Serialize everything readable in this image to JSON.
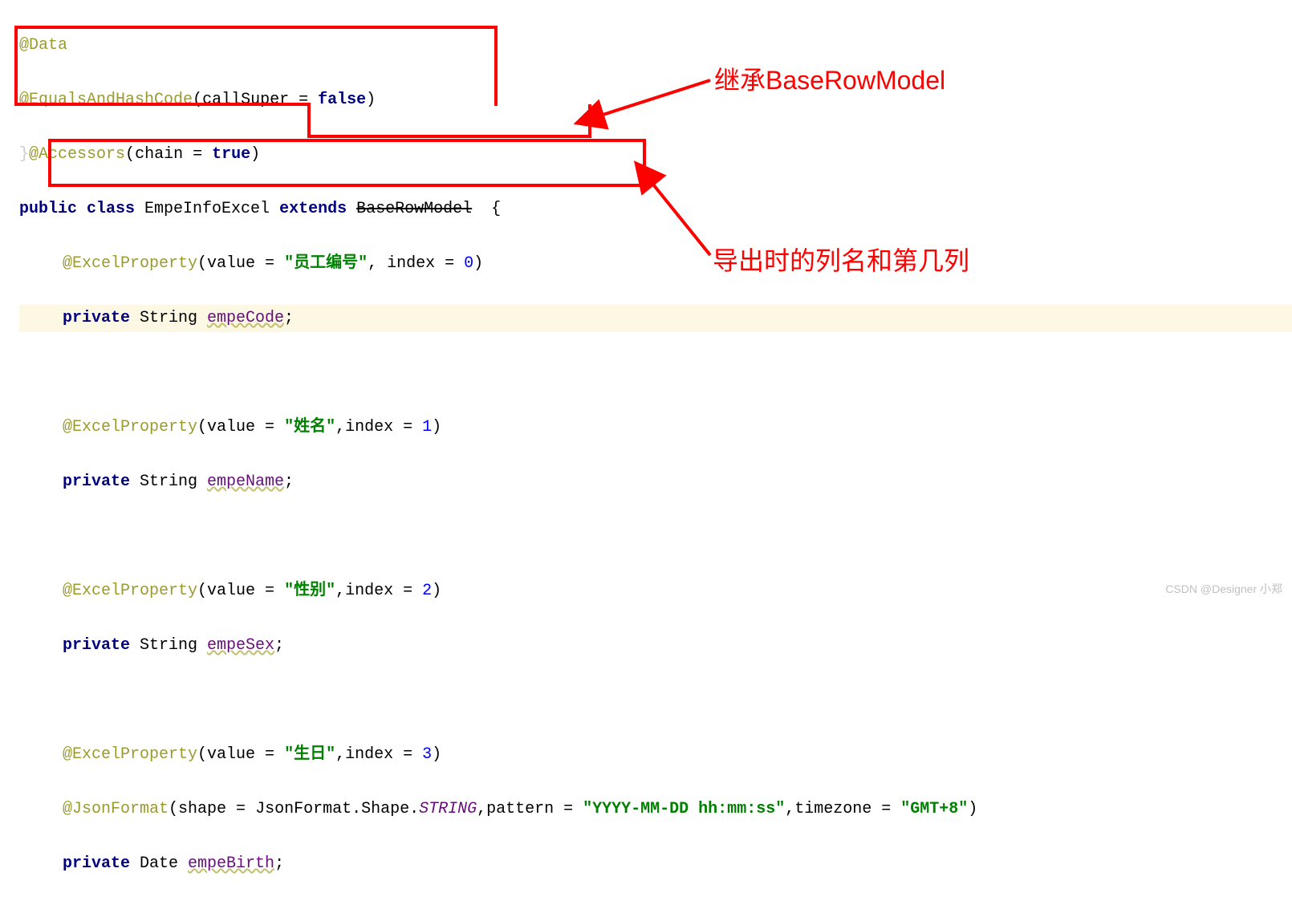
{
  "code": {
    "l1_anno": "@Data",
    "l2_anno": "@EqualsAndHashCode",
    "l2_paren_open": "(",
    "l2_param": "callSuper = ",
    "l2_val": "false",
    "l2_paren_close": ")",
    "l3_extra": "}",
    "l3_anno": "@Accessors",
    "l3_paren_open": "(",
    "l3_param": "chain = ",
    "l3_val": "true",
    "l3_paren_close": ")",
    "l4_public": "public",
    "l4_class": " class ",
    "l4_name": "EmpeInfoExcel",
    "l4_extends": " extends ",
    "l4_base": "BaseRowModel",
    "l4_brace": "  {",
    "l5_anno": "@ExcelProperty",
    "l5_paren_open": "(",
    "l5_value_kw": "value = ",
    "l5_value_str": "\"员工编号\"",
    "l5_comma": ", index = ",
    "l5_index": "0",
    "l5_paren_close": ")",
    "l6_private": "private",
    "l6_type": " String ",
    "l6_field": "empeCode",
    "l6_semi": ";",
    "l8_anno": "@ExcelProperty",
    "l8_paren_open": "(",
    "l8_value_kw": "value = ",
    "l8_value_str": "\"姓名\"",
    "l8_index_kw": ",index = ",
    "l8_index": "1",
    "l8_paren_close": ")",
    "l9_private": "private",
    "l9_type": " String ",
    "l9_field": "empeName",
    "l9_semi": ";",
    "l11_anno": "@ExcelProperty",
    "l11_paren_open": "(",
    "l11_value_kw": "value = ",
    "l11_value_str": "\"性别\"",
    "l11_index_kw": ",index = ",
    "l11_index": "2",
    "l11_paren_close": ")",
    "l12_private": "private",
    "l12_type": " String ",
    "l12_field": "empeSex",
    "l12_semi": ";",
    "l14_anno": "@ExcelProperty",
    "l14_paren_open": "(",
    "l14_value_kw": "value = ",
    "l14_value_str": "\"生日\"",
    "l14_index_kw": ",index = ",
    "l14_index": "3",
    "l14_paren_close": ")",
    "l15_anno": "@JsonFormat",
    "l15_paren_open": "(",
    "l15_shape_kw": "shape = ",
    "l15_shape_class": "JsonFormat.Shape.",
    "l15_shape_val": "STRING",
    "l15_pattern_kw": ",pattern = ",
    "l15_pattern_str": "\"YYYY-MM-DD hh:mm:ss\"",
    "l15_tz_kw": ",timezone = ",
    "l15_tz_str": "\"GMT+8\"",
    "l15_paren_close": ")",
    "l16_private": "private",
    "l16_type": " Date ",
    "l16_field": "empeBirth",
    "l16_semi": ";"
  },
  "labels": {
    "inherit": "继承BaseRowModel",
    "export_col": "导出时的列名和第几列"
  },
  "watermark": "CSDN @Designer 小郑"
}
